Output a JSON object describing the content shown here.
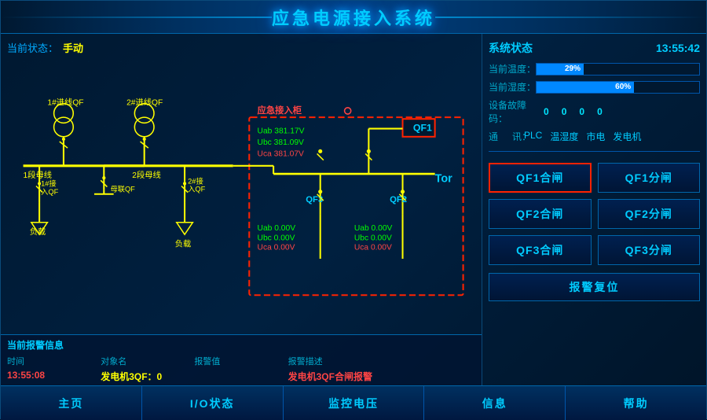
{
  "header": {
    "title": "应急电源接入系统"
  },
  "status_bar": {
    "label": "当前状态：",
    "value": "手动"
  },
  "system_status": {
    "title": "系统状态",
    "time": "13:55:42",
    "temperature_label": "当前温度：",
    "temperature_value": "29%",
    "temperature_percent": 29,
    "humidity_label": "当前湿度：",
    "humidity_value": "60%",
    "humidity_percent": 60,
    "fault_label": "设备故障码：",
    "fault_values": [
      "0",
      "0",
      "0",
      "0"
    ],
    "comm_label": "通",
    "comm_label2": "讯：",
    "comm_items": [
      "PLC",
      "温湿度",
      "市电",
      "发电机"
    ]
  },
  "emergency_box": {
    "title": "应急接入柜",
    "uab1_label": "Uab",
    "uab1_value": "381.17V",
    "ubc1_label": "Ubc",
    "ubc1_value": "381.09V",
    "uca1_label": "Uca",
    "uca1_value": "381.07V",
    "qf1_label": "QF1",
    "uab2_label": "Uab",
    "uab2_value": "0.00V",
    "ubc2_label": "Ubc",
    "ubc2_value": "0.00V",
    "uca2_label": "Uca",
    "uca2_value": "0.00V",
    "qf3_label": "QF3",
    "uab3_label": "Uab",
    "uab3_value": "0.00V",
    "ubc3_label": "Ubc",
    "ubc3_value": "0.00V",
    "uca3_label": "Uca",
    "uca3_value": "0.00V",
    "qf2_label": "QF2"
  },
  "diagram": {
    "feeder1": "1#进线QF",
    "feeder2": "2#进线QF",
    "bus1": "1段母线",
    "bus2": "2段母线",
    "coupler": "母联QF",
    "inlet1": "1#接入QF",
    "inlet2": "2#接",
    "inlet2b": "入QF",
    "load1": "负载",
    "load2": "负载"
  },
  "control_buttons": [
    {
      "id": "qf1-close",
      "label": "QF1合闸",
      "active": true
    },
    {
      "id": "qf1-open",
      "label": "QF1分闸",
      "active": false
    },
    {
      "id": "qf2-close",
      "label": "QF2合闸",
      "active": false
    },
    {
      "id": "qf2-open",
      "label": "QF2分闸",
      "active": false
    },
    {
      "id": "qf3-close",
      "label": "QF3合闸",
      "active": false
    },
    {
      "id": "qf3-open",
      "label": "QF3分闸",
      "active": false
    }
  ],
  "alert_reset": "报警复位",
  "alert_section": {
    "title": "当前报警信息",
    "headers": [
      "时间",
      "对象名",
      "报警值",
      "报警描述"
    ],
    "rows": [
      {
        "time": "13:55:08",
        "object": "发电机3QF：0",
        "value": "",
        "description": "发电机3QF合闸报警"
      }
    ]
  },
  "bottom_nav": [
    {
      "id": "home",
      "label": "主页"
    },
    {
      "id": "io-status",
      "label": "I/O状态"
    },
    {
      "id": "monitor-voltage",
      "label": "监控电压"
    },
    {
      "id": "info",
      "label": "信息"
    },
    {
      "id": "help",
      "label": "帮助"
    }
  ]
}
